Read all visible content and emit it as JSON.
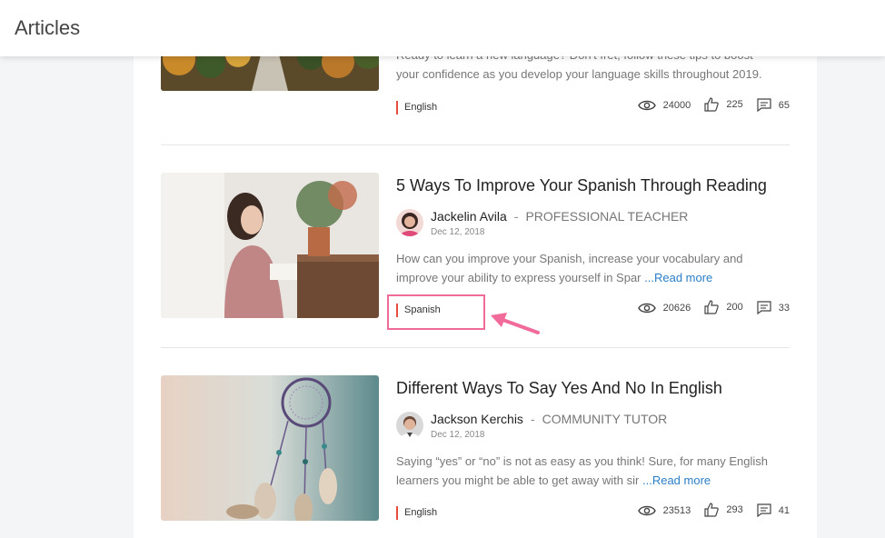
{
  "header": {
    "title": "Articles"
  },
  "articles": [
    {
      "excerpt_line1": "Ready to learn a new language? Don't fret, follow these tips to boost",
      "excerpt_line2": "your confidence as you develop your language skills throughout 2019.",
      "tag": "English",
      "views": "24000",
      "likes": "225",
      "comments": "65"
    },
    {
      "title": "5 Ways To Improve Your Spanish Through Reading",
      "author": "Jackelin Avila",
      "separator": "-",
      "role": "PROFESSIONAL TEACHER",
      "date": "Dec 12, 2018",
      "excerpt_line1": "How can you improve your Spanish, increase your vocabulary and",
      "excerpt_line2": "improve your ability to express yourself in Spar",
      "read_more": "...Read more",
      "tag": "Spanish",
      "views": "20626",
      "likes": "200",
      "comments": "33"
    },
    {
      "title": "Different Ways To Say Yes And No In English",
      "author": "Jackson Kerchis",
      "separator": "-",
      "role": "COMMUNITY TUTOR",
      "date": "Dec 12, 2018",
      "excerpt_line1": "Saying “yes” or “no” is not as easy as you think! Sure, for many English",
      "excerpt_line2": "learners you might be able to get away with sir",
      "read_more": "...Read more",
      "tag": "English",
      "views": "23513",
      "likes": "293",
      "comments": "41"
    }
  ],
  "icons": {
    "views": "eye-icon",
    "likes": "thumbs-up-icon",
    "comments": "comment-icon"
  },
  "colors": {
    "tag_bar": "#e74c3c",
    "read_more": "#2a7ec8",
    "highlight": "#f06a9a"
  }
}
